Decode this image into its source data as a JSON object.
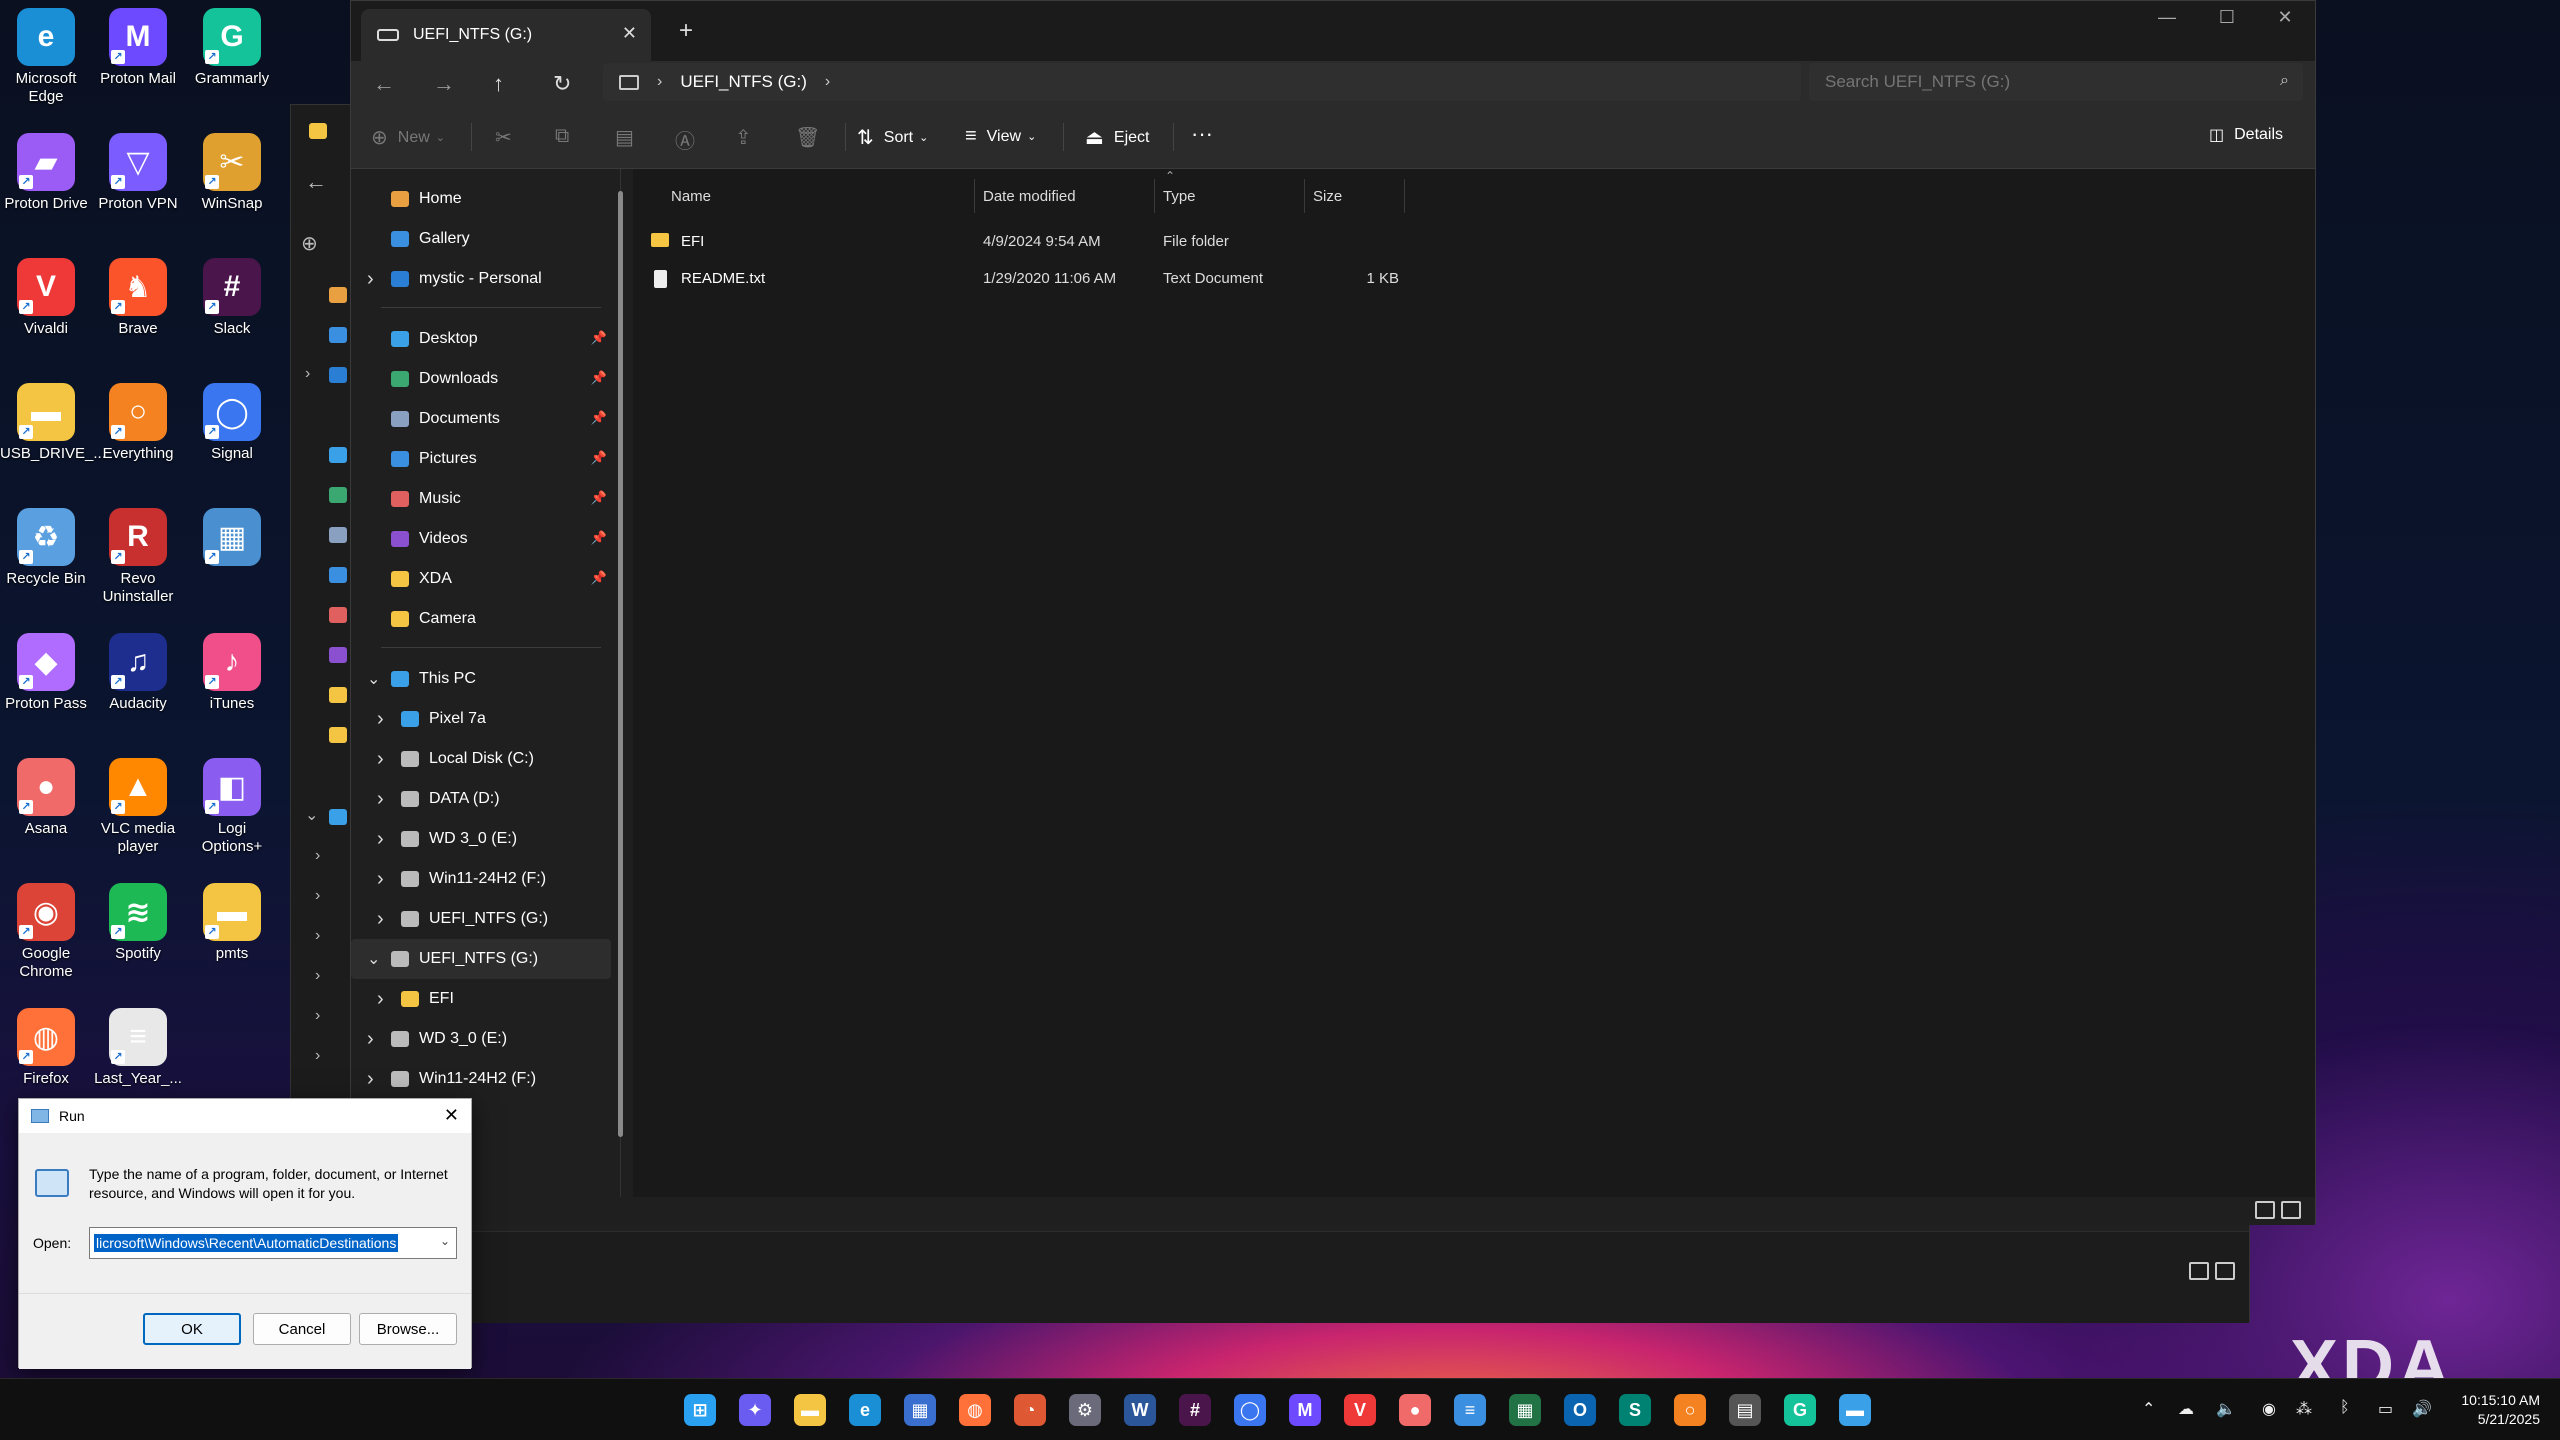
{
  "desktop": {
    "icons": [
      {
        "label": "Microsoft Edge",
        "color": "#1b8fd6",
        "glyph": "e"
      },
      {
        "label": "Proton Mail",
        "color": "#6d4aff",
        "glyph": "M"
      },
      {
        "label": "Grammarly",
        "color": "#15c39a",
        "glyph": "G"
      },
      {
        "label": "Proton Drive",
        "color": "#9b5cf6",
        "glyph": "▰"
      },
      {
        "label": "Proton VPN",
        "color": "#7a5cff",
        "glyph": "▽"
      },
      {
        "label": "WinSnap",
        "color": "#e0a030",
        "glyph": "✂"
      },
      {
        "label": "Vivaldi",
        "color": "#ef3939",
        "glyph": "V"
      },
      {
        "label": "Brave",
        "color": "#fb542b",
        "glyph": "♞"
      },
      {
        "label": "Slack",
        "color": "#4a154b",
        "glyph": "#"
      },
      {
        "label": "USB_DRIVE_...",
        "color": "#f4c542",
        "glyph": "▬"
      },
      {
        "label": "Everything",
        "color": "#f58220",
        "glyph": "○"
      },
      {
        "label": "Signal",
        "color": "#3a76f0",
        "glyph": "◯"
      },
      {
        "label": "Recycle Bin",
        "color": "#5aa0e0",
        "glyph": "♻"
      },
      {
        "label": "Revo Uninstaller",
        "color": "#c83030",
        "glyph": "R"
      },
      {
        "label": "",
        "color": "#4a90d0",
        "glyph": "▦"
      },
      {
        "label": "Proton Pass",
        "color": "#b06cff",
        "glyph": "◆"
      },
      {
        "label": "Audacity",
        "color": "#1d2e8f",
        "glyph": "♫"
      },
      {
        "label": "iTunes",
        "color": "#f04f8a",
        "glyph": "♪"
      },
      {
        "label": "Asana",
        "color": "#f06a6a",
        "glyph": "●"
      },
      {
        "label": "VLC media player",
        "color": "#ff8800",
        "glyph": "▲"
      },
      {
        "label": "Logi Options+",
        "color": "#8a5cf0",
        "glyph": "◧"
      },
      {
        "label": "Google Chrome",
        "color": "#db4437",
        "glyph": "◉"
      },
      {
        "label": "Spotify",
        "color": "#1db954",
        "glyph": "≋"
      },
      {
        "label": "pmts",
        "color": "#f4c542",
        "glyph": "▬"
      },
      {
        "label": "Firefox",
        "color": "#ff7139",
        "glyph": "◍"
      },
      {
        "label": "Last_Year_...",
        "color": "#e8e8e8",
        "glyph": "≡"
      }
    ]
  },
  "explorer": {
    "tab_title": "UEFI_NTFS (G:)",
    "address": {
      "location": "UEFI_NTFS (G:)"
    },
    "search_placeholder": "Search UEFI_NTFS (G:)",
    "commands": {
      "new": "New",
      "sort": "Sort",
      "view": "View",
      "eject": "Eject",
      "more": "···",
      "details": "Details"
    },
    "nav": {
      "quick": [
        {
          "label": "Home",
          "color": "#e8a040"
        },
        {
          "label": "Gallery",
          "color": "#3a8fe0"
        },
        {
          "label": "mystic - Personal",
          "color": "#2a7fd4",
          "chevron": true
        }
      ],
      "pinned": [
        {
          "label": "Desktop",
          "color": "#3aa0e8"
        },
        {
          "label": "Downloads",
          "color": "#3aa870"
        },
        {
          "label": "Documents",
          "color": "#8aa0c0"
        },
        {
          "label": "Pictures",
          "color": "#3a8fe0"
        },
        {
          "label": "Music",
          "color": "#e06060"
        },
        {
          "label": "Videos",
          "color": "#8a50d0"
        },
        {
          "label": "XDA",
          "color": "#f4c542"
        },
        {
          "label": "Camera",
          "color": "#f4c542",
          "nopin": true
        }
      ],
      "this_pc": {
        "label": "This PC",
        "color": "#3aa0e8"
      },
      "drives": [
        {
          "label": "Pixel 7a",
          "color": "#3aa0e8"
        },
        {
          "label": "Local Disk (C:)",
          "color": "#bbb"
        },
        {
          "label": "DATA (D:)",
          "color": "#bbb"
        },
        {
          "label": "WD 3_0 (E:)",
          "color": "#bbb"
        },
        {
          "label": "Win11-24H2 (F:)",
          "color": "#bbb"
        },
        {
          "label": "UEFI_NTFS (G:)",
          "color": "#bbb"
        }
      ],
      "expanded": {
        "label": "UEFI_NTFS (G:)",
        "child": "EFI"
      },
      "after": [
        {
          "label": "WD 3_0 (E:)"
        },
        {
          "label": "Win11-24H2 (F:)"
        }
      ]
    },
    "columns": {
      "name": "Name",
      "date": "Date modified",
      "type": "Type",
      "size": "Size"
    },
    "files": [
      {
        "name": "EFI",
        "date": "4/9/2024 9:54 AM",
        "type": "File folder",
        "size": "",
        "kind": "folder"
      },
      {
        "name": "README.txt",
        "date": "1/29/2020 11:06 AM",
        "type": "Text Document",
        "size": "1 KB",
        "kind": "doc"
      }
    ]
  },
  "run_dialog": {
    "title": "Run",
    "description": "Type the name of a program, folder, document, or Internet resource, and Windows will open it for you.",
    "open_label": "Open:",
    "open_value": "licrosoft\\Windows\\Recent\\AutomaticDestinations",
    "ok": "OK",
    "cancel": "Cancel",
    "browse": "Browse..."
  },
  "taskbar": {
    "apps": [
      {
        "name": "start",
        "color": "#2aa0f0",
        "glyph": "⊞"
      },
      {
        "name": "copilot",
        "color": "#6a5cf0",
        "glyph": "✦"
      },
      {
        "name": "file-explorer",
        "color": "#f4c542",
        "glyph": "▬"
      },
      {
        "name": "edge",
        "color": "#1b8fd6",
        "glyph": "e"
      },
      {
        "name": "store",
        "color": "#3a6fd0",
        "glyph": "▦"
      },
      {
        "name": "firefox",
        "color": "#ff7139",
        "glyph": "◍"
      },
      {
        "name": "duckduckgo",
        "color": "#de5833",
        "glyph": "◔"
      },
      {
        "name": "settings",
        "color": "#6a6a7a",
        "glyph": "⚙"
      },
      {
        "name": "word",
        "color": "#2b579a",
        "glyph": "W"
      },
      {
        "name": "slack",
        "color": "#4a154b",
        "glyph": "#"
      },
      {
        "name": "signal",
        "color": "#3a76f0",
        "glyph": "◯"
      },
      {
        "name": "proton-mail",
        "color": "#6d4aff",
        "glyph": "M"
      },
      {
        "name": "vivaldi",
        "color": "#ef3939",
        "glyph": "V"
      },
      {
        "name": "asana",
        "color": "#f06a6a",
        "glyph": "●"
      },
      {
        "name": "notepad",
        "color": "#3a8fe0",
        "glyph": "≡"
      },
      {
        "name": "excel",
        "color": "#217346",
        "glyph": "▦"
      },
      {
        "name": "outlook",
        "color": "#0a64b0",
        "glyph": "O"
      },
      {
        "name": "sway",
        "color": "#008272",
        "glyph": "S"
      },
      {
        "name": "everything",
        "color": "#f58220",
        "glyph": "○"
      },
      {
        "name": "calculator",
        "color": "#555",
        "glyph": "▤"
      },
      {
        "name": "grammarly",
        "color": "#15c39a",
        "glyph": "G"
      },
      {
        "name": "notes",
        "color": "#3aa0e8",
        "glyph": "▬"
      }
    ],
    "time": "10:15:10 AM",
    "date": "5/21/2025"
  },
  "watermark": "XDA"
}
